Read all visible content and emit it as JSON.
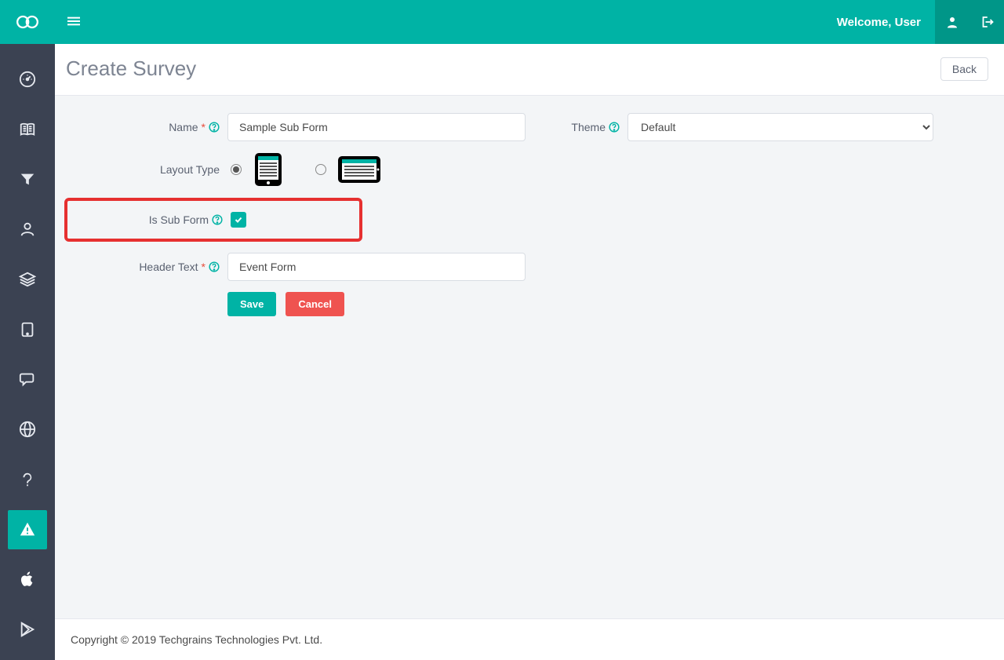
{
  "header": {
    "welcome": "Welcome, User"
  },
  "page": {
    "title": "Create Survey",
    "back": "Back"
  },
  "form": {
    "name_label": "Name",
    "name_value": "Sample Sub Form",
    "layout_label": "Layout Type",
    "subform_label": "Is Sub Form",
    "subform_checked": true,
    "headertext_label": "Header Text",
    "headertext_value": "Event Form",
    "theme_label": "Theme",
    "theme_value": "Default",
    "save": "Save",
    "cancel": "Cancel"
  },
  "footer": {
    "copyright": "Copyright © 2019 Techgrains Technologies Pvt. Ltd."
  }
}
